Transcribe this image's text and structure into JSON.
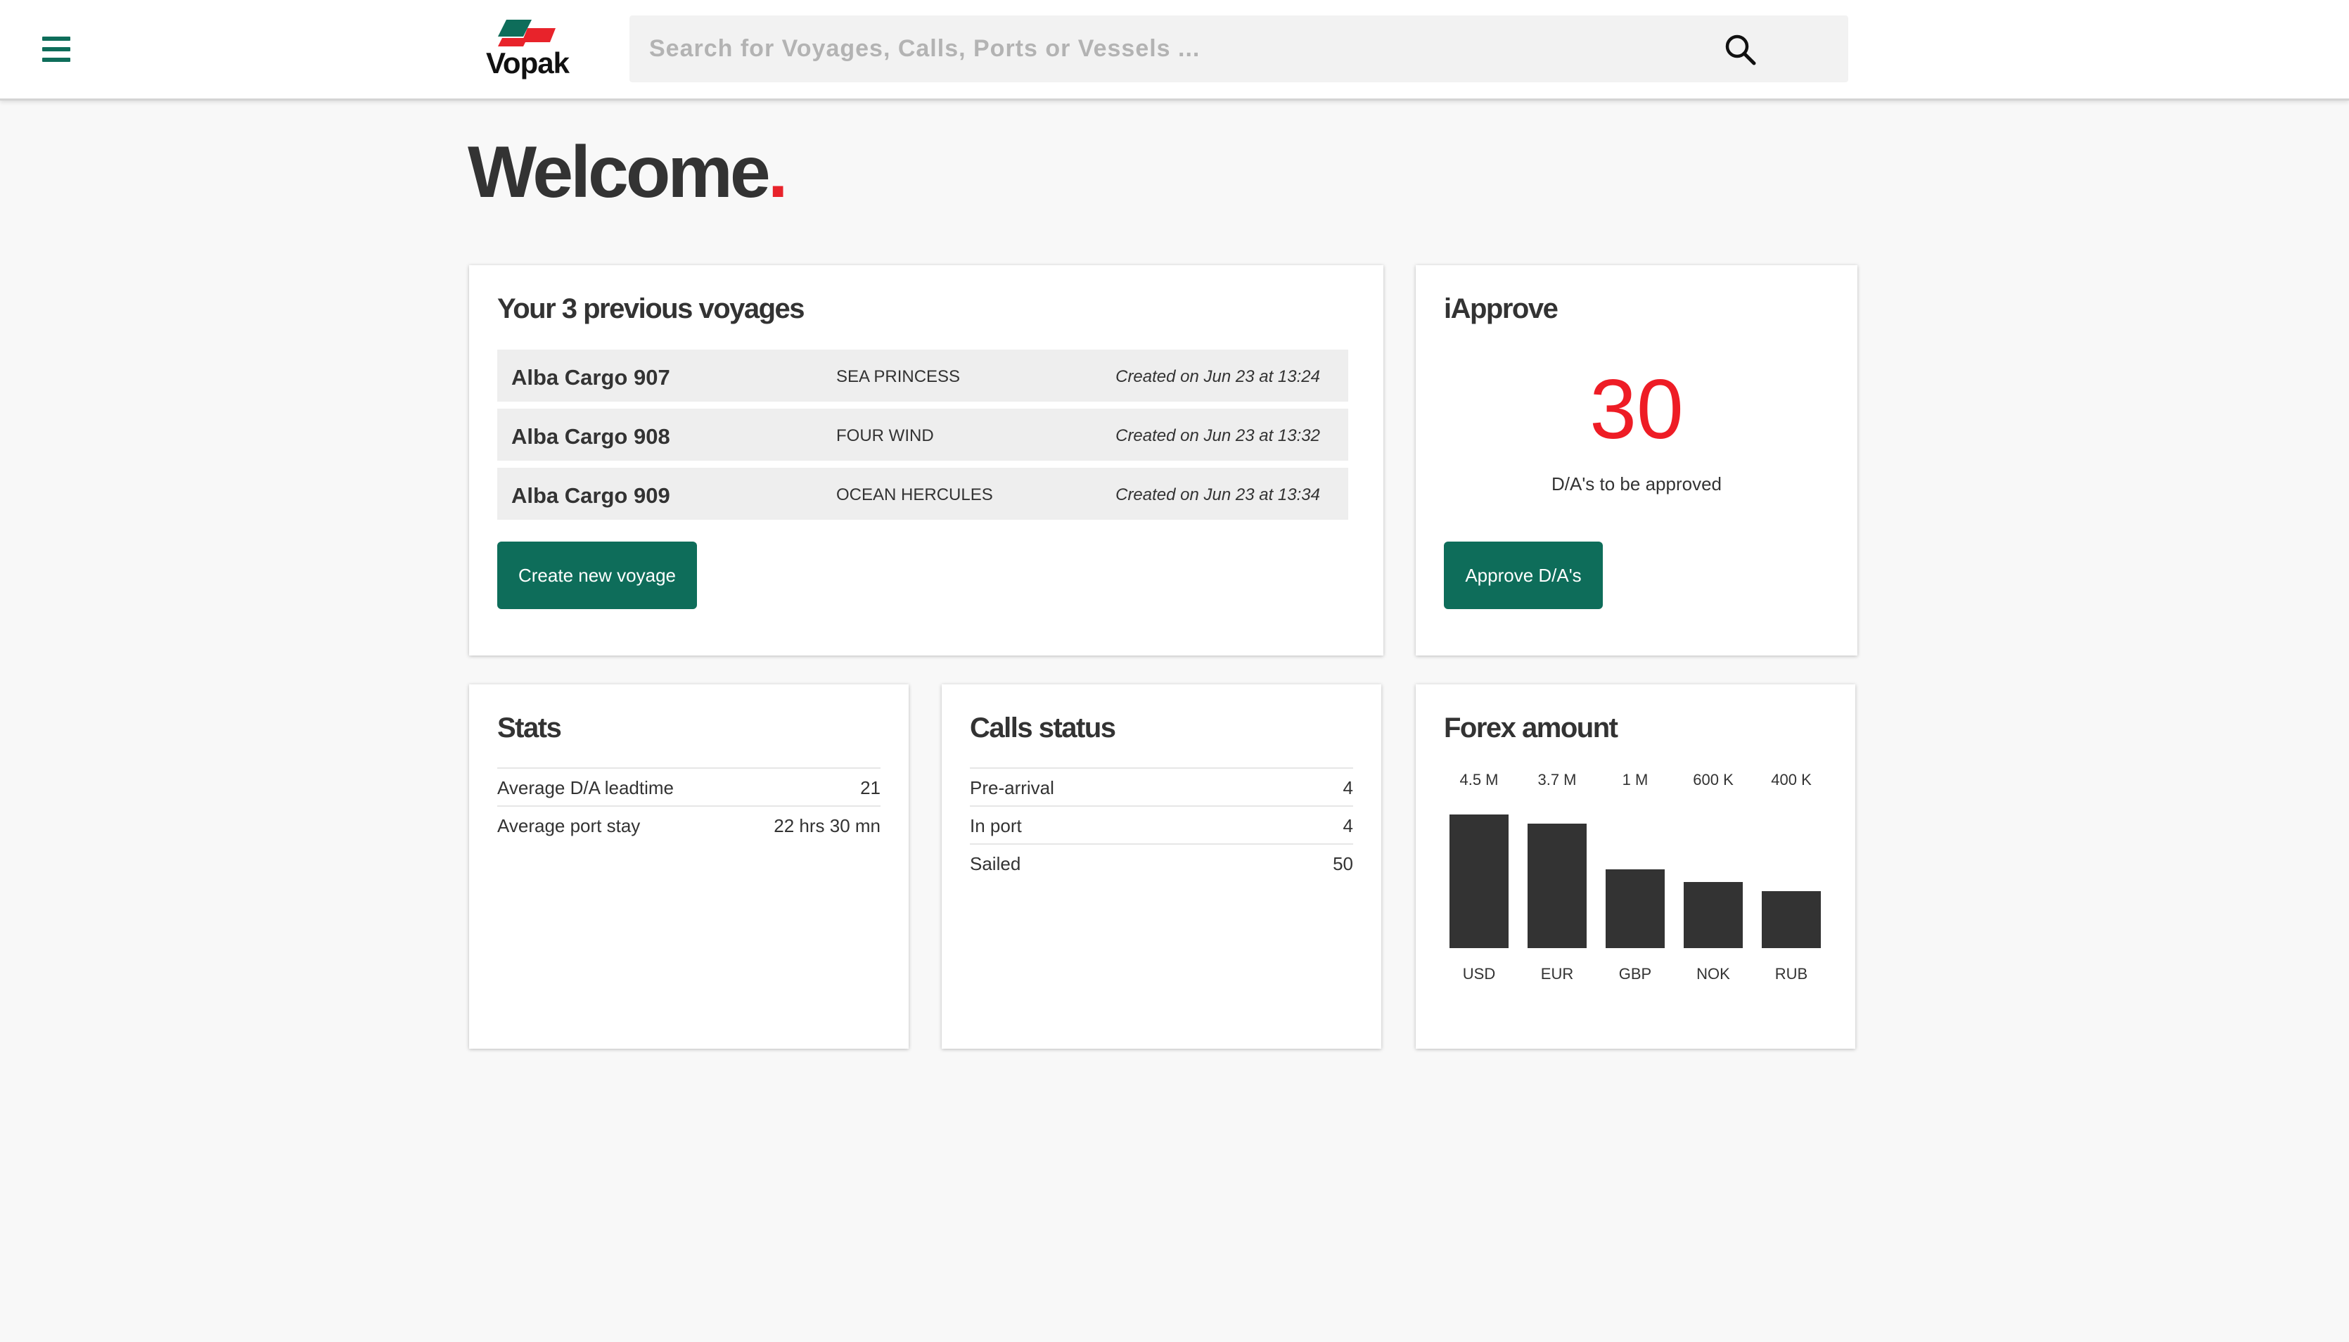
{
  "header": {
    "brand": "Vopak",
    "search_placeholder": "Search for Voyages, Calls, Ports or Vessels ..."
  },
  "welcome": {
    "text": "Welcome",
    "dot": "."
  },
  "voyages": {
    "title": "Your 3 previous voyages",
    "items": [
      {
        "name": "Alba Cargo 907",
        "vessel": "SEA PRINCESS",
        "created": "Created on Jun 23 at 13:24"
      },
      {
        "name": "Alba Cargo 908",
        "vessel": "FOUR WIND",
        "created": "Created on Jun 23 at 13:32"
      },
      {
        "name": "Alba Cargo 909",
        "vessel": "OCEAN HERCULES",
        "created": "Created on Jun 23 at 13:34"
      }
    ],
    "button": "Create new voyage"
  },
  "iapprove": {
    "title": "iApprove",
    "count": "30",
    "label": "D/A's to be approved",
    "button": "Approve D/A's"
  },
  "stats": {
    "title": "Stats",
    "rows": [
      {
        "label": "Average D/A leadtime",
        "value": "21"
      },
      {
        "label": "Average port stay",
        "value": "22 hrs 30 mn"
      }
    ]
  },
  "calls": {
    "title": "Calls status",
    "rows": [
      {
        "label": "Pre-arrival",
        "value": "4"
      },
      {
        "label": "In port",
        "value": "4"
      },
      {
        "label": "Sailed",
        "value": "50"
      }
    ]
  },
  "forex": {
    "title": "Forex amount",
    "labels": [
      "4.5 M",
      "3.7 M",
      "1 M",
      "600 K",
      "400 K"
    ]
  },
  "chart_data": {
    "type": "bar",
    "title": "Forex amount",
    "categories": [
      "USD",
      "EUR",
      "GBP",
      "NOK",
      "RUB"
    ],
    "values": [
      4500000,
      3700000,
      1000000,
      600000,
      400000
    ],
    "data_labels": [
      "4.5 M",
      "3.7 M",
      "1 M",
      "600 K",
      "400 K"
    ]
  },
  "colors": {
    "brand_green": "#0e6d5a",
    "accent_red": "#ee1c25",
    "bar": "#333333"
  }
}
